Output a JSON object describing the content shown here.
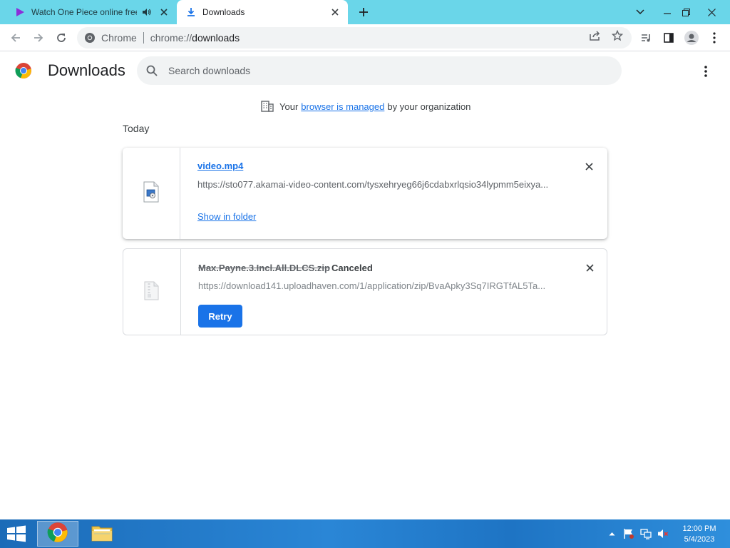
{
  "tabs": [
    {
      "title": "Watch One Piece online free",
      "active": false,
      "audio": true,
      "favicon": "play-icon"
    },
    {
      "title": "Downloads",
      "active": true,
      "favicon": "download-icon"
    }
  ],
  "omnibox": {
    "chip_label": "Chrome",
    "url_scheme": "chrome://",
    "url_host": "downloads"
  },
  "page": {
    "title": "Downloads",
    "search_placeholder": "Search downloads",
    "managed": {
      "prefix": "Your",
      "link": "browser is managed",
      "suffix": "by your organization"
    },
    "section": "Today"
  },
  "downloads": [
    {
      "filename": "video.mp4",
      "url": "https://sto077.akamai-video-content.com/tysxehryeg66j6cdabxrlqsio34lypmm5eixya...",
      "action": "Show in folder",
      "status": ""
    },
    {
      "filename": "Max.Payne.3.Incl.All.DLCS.zip",
      "status": "Canceled",
      "url": "https://download141.uploadhaven.com/1/application/zip/BvaApky3Sq7IRGTfAL5Ta...",
      "action": "Retry"
    }
  ],
  "taskbar": {
    "time": "12:00 PM",
    "date": "5/4/2023"
  },
  "colors": {
    "tab_strip": "#6ad6e9",
    "accent": "#1a73e8",
    "taskbar": "#2a86d6"
  }
}
